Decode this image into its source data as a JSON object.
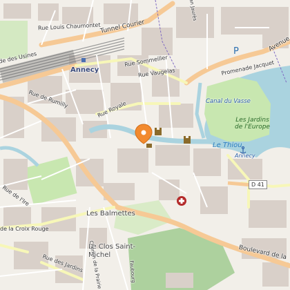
{
  "map": {
    "colors": {
      "land": "#f2efe9",
      "building": "#d9d0c9",
      "lake": "#aad3df",
      "park": "#c8e7b0",
      "major_road": "#f6c995",
      "secondary_road": "#f7f7b8",
      "railway": "#888888",
      "pin": "#f28a2e",
      "hospital": "#b42b2b"
    },
    "labels": {
      "rue_louis_chaumontet": "Rue Louis Chaumontet",
      "tunnel_courier": "Tunnel Courier",
      "rue_des_usines": "de des Usines",
      "annecy_station": "Annecy",
      "rue_sommeiller": "Rue Sommeiller",
      "rue_vaugelas": "Rue Vaugelas",
      "rue_de_rumilly": "Rue de Rumilly",
      "rue_royale": "Rue Royale",
      "avenue": "Avenue",
      "promenade_jacquet": "Promenade Jacquet",
      "canal_du_vasse": "Canal du Vasse",
      "les_jardins_de_l_europe": "Les Jardins de l'Europe",
      "le_thiou": "Le Thiou",
      "annecy_small": "Annecy",
      "d41": "D 41",
      "rue_de_l_ire": "Rue de l'Ire",
      "les_balmettes": "Les Balmettes",
      "rue_de_la_croix_rouge": "de la Croix Rouge",
      "le_clos_saint_michel": "Le Clos Saint-Michel",
      "rue_des_jardins": "Rue des Jardins",
      "chemin_de_la_prairie": "Chemin de la Prairie",
      "faubourg": "Faubourg",
      "boulevard_de_la": "Boulevard de la",
      "rue_jean_jaures": "Rue Jean Jaurès",
      "parking": "P"
    },
    "icons": [
      "location-pin-icon",
      "castle-icon",
      "hospital-icon",
      "anchor-icon",
      "parking-icon",
      "train-station-icon"
    ]
  }
}
